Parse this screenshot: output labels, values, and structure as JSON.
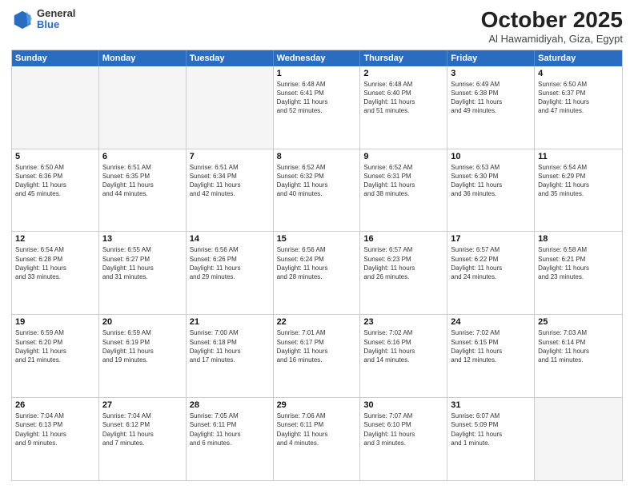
{
  "logo": {
    "general": "General",
    "blue": "Blue"
  },
  "header": {
    "month": "October 2025",
    "location": "Al Hawamidiyah, Giza, Egypt"
  },
  "weekdays": [
    "Sunday",
    "Monday",
    "Tuesday",
    "Wednesday",
    "Thursday",
    "Friday",
    "Saturday"
  ],
  "weeks": [
    [
      {
        "day": "",
        "info": ""
      },
      {
        "day": "",
        "info": ""
      },
      {
        "day": "",
        "info": ""
      },
      {
        "day": "1",
        "info": "Sunrise: 6:48 AM\nSunset: 6:41 PM\nDaylight: 11 hours\nand 52 minutes."
      },
      {
        "day": "2",
        "info": "Sunrise: 6:48 AM\nSunset: 6:40 PM\nDaylight: 11 hours\nand 51 minutes."
      },
      {
        "day": "3",
        "info": "Sunrise: 6:49 AM\nSunset: 6:38 PM\nDaylight: 11 hours\nand 49 minutes."
      },
      {
        "day": "4",
        "info": "Sunrise: 6:50 AM\nSunset: 6:37 PM\nDaylight: 11 hours\nand 47 minutes."
      }
    ],
    [
      {
        "day": "5",
        "info": "Sunrise: 6:50 AM\nSunset: 6:36 PM\nDaylight: 11 hours\nand 45 minutes."
      },
      {
        "day": "6",
        "info": "Sunrise: 6:51 AM\nSunset: 6:35 PM\nDaylight: 11 hours\nand 44 minutes."
      },
      {
        "day": "7",
        "info": "Sunrise: 6:51 AM\nSunset: 6:34 PM\nDaylight: 11 hours\nand 42 minutes."
      },
      {
        "day": "8",
        "info": "Sunrise: 6:52 AM\nSunset: 6:32 PM\nDaylight: 11 hours\nand 40 minutes."
      },
      {
        "day": "9",
        "info": "Sunrise: 6:52 AM\nSunset: 6:31 PM\nDaylight: 11 hours\nand 38 minutes."
      },
      {
        "day": "10",
        "info": "Sunrise: 6:53 AM\nSunset: 6:30 PM\nDaylight: 11 hours\nand 36 minutes."
      },
      {
        "day": "11",
        "info": "Sunrise: 6:54 AM\nSunset: 6:29 PM\nDaylight: 11 hours\nand 35 minutes."
      }
    ],
    [
      {
        "day": "12",
        "info": "Sunrise: 6:54 AM\nSunset: 6:28 PM\nDaylight: 11 hours\nand 33 minutes."
      },
      {
        "day": "13",
        "info": "Sunrise: 6:55 AM\nSunset: 6:27 PM\nDaylight: 11 hours\nand 31 minutes."
      },
      {
        "day": "14",
        "info": "Sunrise: 6:56 AM\nSunset: 6:26 PM\nDaylight: 11 hours\nand 29 minutes."
      },
      {
        "day": "15",
        "info": "Sunrise: 6:56 AM\nSunset: 6:24 PM\nDaylight: 11 hours\nand 28 minutes."
      },
      {
        "day": "16",
        "info": "Sunrise: 6:57 AM\nSunset: 6:23 PM\nDaylight: 11 hours\nand 26 minutes."
      },
      {
        "day": "17",
        "info": "Sunrise: 6:57 AM\nSunset: 6:22 PM\nDaylight: 11 hours\nand 24 minutes."
      },
      {
        "day": "18",
        "info": "Sunrise: 6:58 AM\nSunset: 6:21 PM\nDaylight: 11 hours\nand 23 minutes."
      }
    ],
    [
      {
        "day": "19",
        "info": "Sunrise: 6:59 AM\nSunset: 6:20 PM\nDaylight: 11 hours\nand 21 minutes."
      },
      {
        "day": "20",
        "info": "Sunrise: 6:59 AM\nSunset: 6:19 PM\nDaylight: 11 hours\nand 19 minutes."
      },
      {
        "day": "21",
        "info": "Sunrise: 7:00 AM\nSunset: 6:18 PM\nDaylight: 11 hours\nand 17 minutes."
      },
      {
        "day": "22",
        "info": "Sunrise: 7:01 AM\nSunset: 6:17 PM\nDaylight: 11 hours\nand 16 minutes."
      },
      {
        "day": "23",
        "info": "Sunrise: 7:02 AM\nSunset: 6:16 PM\nDaylight: 11 hours\nand 14 minutes."
      },
      {
        "day": "24",
        "info": "Sunrise: 7:02 AM\nSunset: 6:15 PM\nDaylight: 11 hours\nand 12 minutes."
      },
      {
        "day": "25",
        "info": "Sunrise: 7:03 AM\nSunset: 6:14 PM\nDaylight: 11 hours\nand 11 minutes."
      }
    ],
    [
      {
        "day": "26",
        "info": "Sunrise: 7:04 AM\nSunset: 6:13 PM\nDaylight: 11 hours\nand 9 minutes."
      },
      {
        "day": "27",
        "info": "Sunrise: 7:04 AM\nSunset: 6:12 PM\nDaylight: 11 hours\nand 7 minutes."
      },
      {
        "day": "28",
        "info": "Sunrise: 7:05 AM\nSunset: 6:11 PM\nDaylight: 11 hours\nand 6 minutes."
      },
      {
        "day": "29",
        "info": "Sunrise: 7:06 AM\nSunset: 6:11 PM\nDaylight: 11 hours\nand 4 minutes."
      },
      {
        "day": "30",
        "info": "Sunrise: 7:07 AM\nSunset: 6:10 PM\nDaylight: 11 hours\nand 3 minutes."
      },
      {
        "day": "31",
        "info": "Sunrise: 6:07 AM\nSunset: 5:09 PM\nDaylight: 11 hours\nand 1 minute."
      },
      {
        "day": "",
        "info": ""
      }
    ]
  ]
}
